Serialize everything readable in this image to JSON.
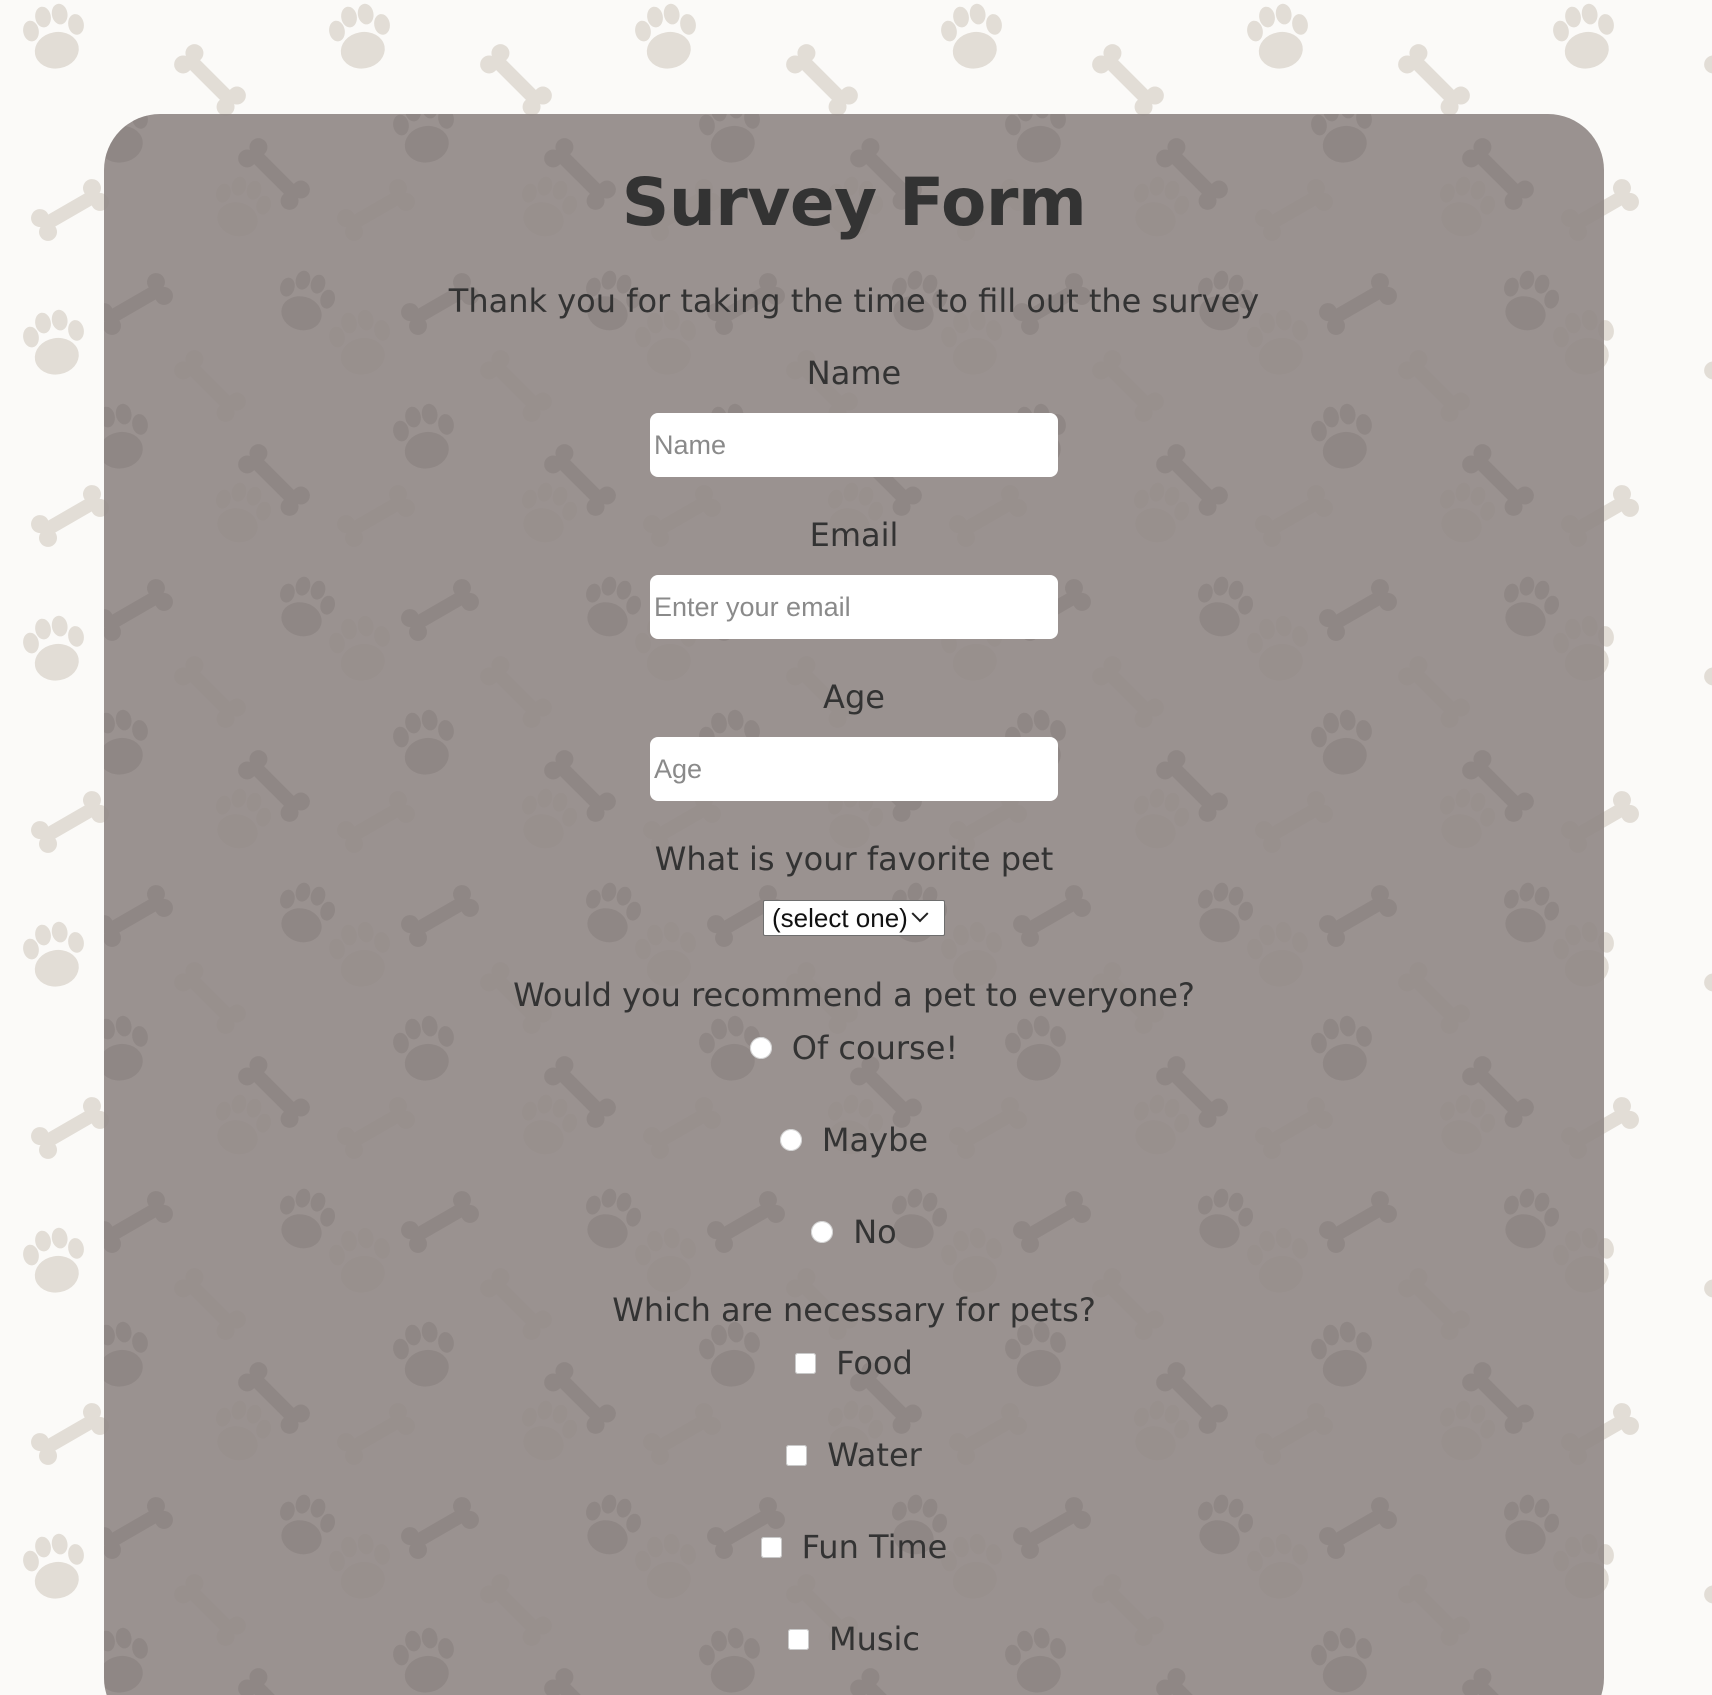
{
  "form": {
    "title": "Survey Form",
    "description": "Thank you for taking the time to fill out the survey",
    "name": {
      "label": "Name",
      "placeholder": "Name",
      "value": ""
    },
    "email": {
      "label": "Email",
      "placeholder": "Enter your email",
      "value": ""
    },
    "age": {
      "label": "Age",
      "placeholder": "Age",
      "value": ""
    },
    "pet": {
      "label": "What is your favorite pet",
      "selected": "(select one)"
    },
    "recommend": {
      "label": "Would you recommend a pet to everyone?",
      "options": [
        "Of course!",
        "Maybe",
        "No"
      ]
    },
    "necessities": {
      "label": "Which are necessary for pets?",
      "options": [
        "Food",
        "Water",
        "Fun Time",
        "Music"
      ]
    }
  },
  "colors": {
    "page_background": "#fbfaf8",
    "pattern": "#e2ddd6",
    "card": "#918987",
    "text": "#333333"
  },
  "icons": {
    "background_pattern": "paw-and-bone-icon",
    "select_indicator": "chevron-down-icon"
  }
}
